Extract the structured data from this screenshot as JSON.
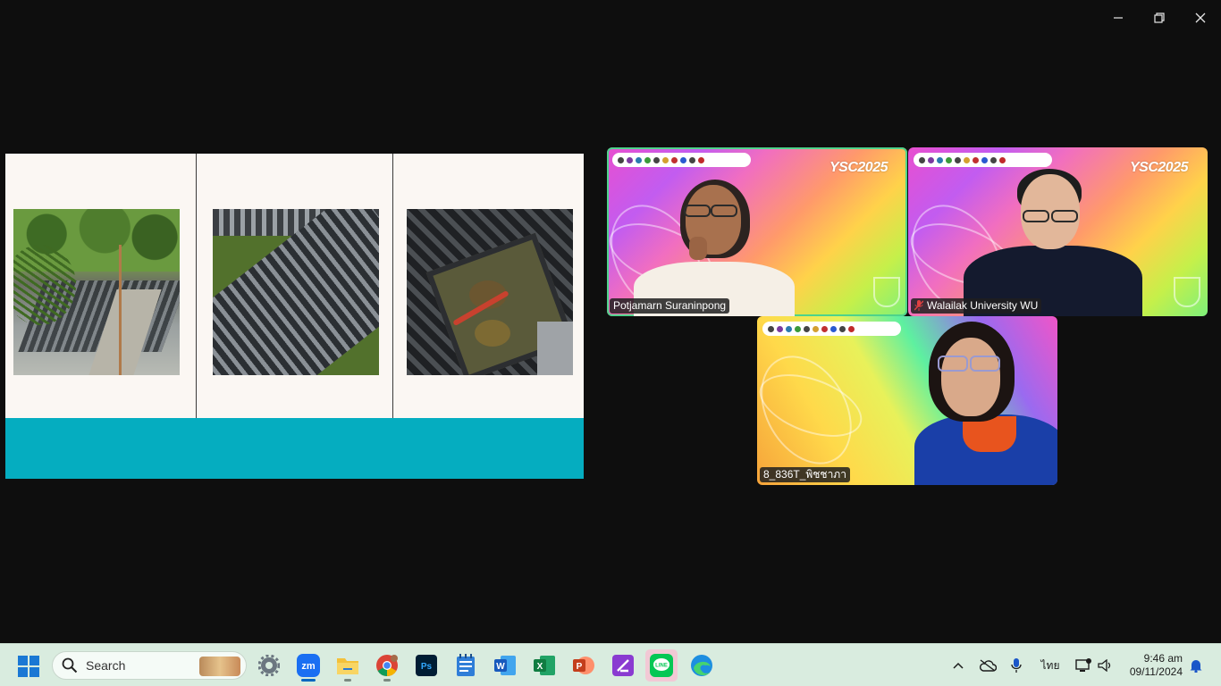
{
  "window": {
    "controls": {
      "minimize_icon": "minimize-icon",
      "restore_icon": "restore-icon",
      "close_icon": "close-icon"
    }
  },
  "shared_slide": {
    "photos": [
      "garden-crate-farm-photo",
      "pond-floating-crates-photo",
      "crab-in-crate-photo"
    ],
    "footer_color": "#05adc0"
  },
  "participants": [
    {
      "name": "Potjamarn Suraninpong",
      "muted": false,
      "active_speaker": true,
      "banner_text": "YSC2025"
    },
    {
      "name": "Walailak University WU",
      "muted": true,
      "active_speaker": false,
      "banner_text": "YSC2025"
    },
    {
      "name": "8_836T_พิชชาภา",
      "muted": false,
      "active_speaker": false,
      "banner_text": ""
    }
  ],
  "taskbar": {
    "search": {
      "label": "Search"
    },
    "apps": [
      {
        "name": "settings",
        "icon": "gear-icon"
      },
      {
        "name": "zoom",
        "icon": "zoom-icon"
      },
      {
        "name": "file-explorer",
        "icon": "folder-icon"
      },
      {
        "name": "chrome",
        "icon": "chrome-icon"
      },
      {
        "name": "photoshop",
        "icon": "photoshop-icon",
        "label": "Ps"
      },
      {
        "name": "notepad",
        "icon": "notepad-icon"
      },
      {
        "name": "word",
        "icon": "word-icon",
        "label": "W"
      },
      {
        "name": "excel",
        "icon": "excel-icon",
        "label": "X"
      },
      {
        "name": "powerpoint",
        "icon": "powerpoint-icon",
        "label": "P"
      },
      {
        "name": "onenote",
        "icon": "onenote-icon"
      },
      {
        "name": "line",
        "icon": "line-icon",
        "label": "LINE"
      },
      {
        "name": "edge",
        "icon": "edge-icon"
      }
    ],
    "tray": {
      "language": "ไทย",
      "time": "9:46 am",
      "date": "09/11/2024"
    },
    "accent": "#0067c0"
  }
}
